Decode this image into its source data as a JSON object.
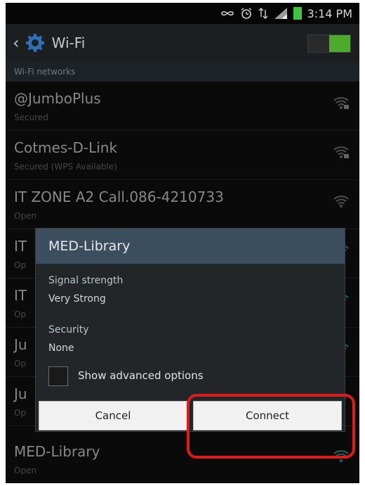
{
  "status_bar": {
    "time": "3:14 PM",
    "icons": [
      "infinity-icon",
      "alarm-icon",
      "data-arrows-icon",
      "signal-icon",
      "battery-icon"
    ]
  },
  "action_bar": {
    "back_icon": "chevron-left-icon",
    "settings_icon": "gear-icon",
    "title": "Wi-Fi",
    "toggle_state": "on",
    "toggle_color": "#4caa2c"
  },
  "section_header": "Wi-Fi networks",
  "networks": [
    {
      "name": "@JumboPlus",
      "status": "Secured",
      "icon": "wifi-locked-icon"
    },
    {
      "name": "Cotmes-D-Link",
      "status": "Secured (WPS Available)",
      "icon": "wifi-locked-icon"
    },
    {
      "name": "IT ZONE A2    Call.086-4210733",
      "status": "Open",
      "icon": "wifi-icon"
    },
    {
      "name": "IT",
      "status": "Op",
      "icon": "wifi-icon"
    },
    {
      "name": "IT",
      "status": "Op",
      "icon": "wifi-icon"
    },
    {
      "name": "Ju",
      "status": "Op",
      "icon": "wifi-icon"
    },
    {
      "name": "Ju",
      "status": "Op",
      "icon": "wifi-icon"
    },
    {
      "name": "MED-Library",
      "status": "Open",
      "icon": "wifi-icon"
    }
  ],
  "dialog": {
    "title": "MED-Library",
    "signal_label": "Signal strength",
    "signal_value": "Very Strong",
    "security_label": "Security",
    "security_value": "None",
    "advanced_label": "Show advanced options",
    "cancel_label": "Cancel",
    "connect_label": "Connect"
  },
  "colors": {
    "highlight": "#e01919",
    "dialog_title_bg": "#3b4e5e",
    "battery": "#3ec43e"
  }
}
